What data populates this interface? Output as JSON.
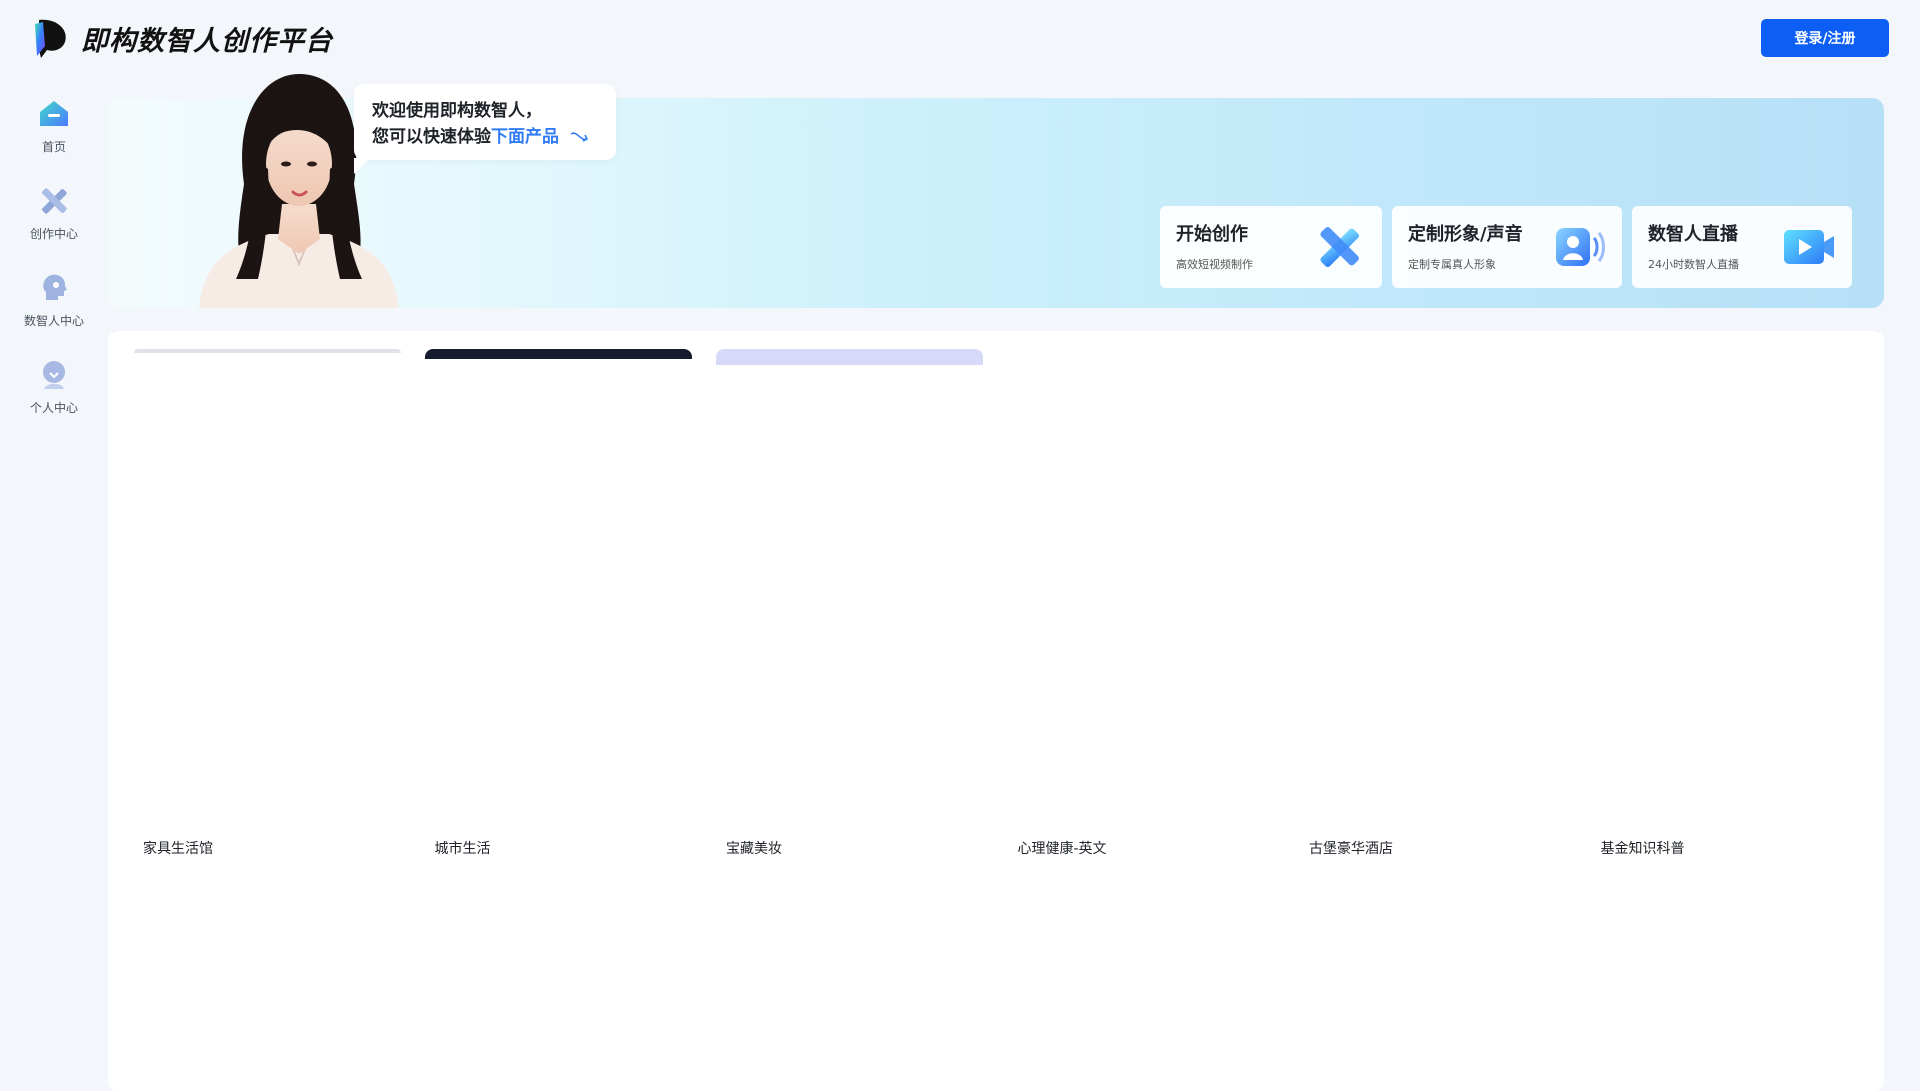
{
  "app": {
    "brand_name": "即构数智人创作平台",
    "login_label": "登录/注册",
    "accent_color": "#0d5ef5"
  },
  "sidebar": {
    "items": [
      {
        "label": "首页",
        "icon": "home-icon"
      },
      {
        "label": "创作中心",
        "icon": "creation-icon"
      },
      {
        "label": "数智人中心",
        "icon": "digital-human-icon"
      },
      {
        "label": "个人中心",
        "icon": "profile-icon"
      }
    ]
  },
  "banner": {
    "greeting_line1": "欢迎使用即构数智人，",
    "greeting_line2_prefix": "您可以快速体验",
    "greeting_line2_highlight": "下面产品",
    "cards": [
      {
        "title": "开始创作",
        "subtitle": "高效短视频制作",
        "icon": "pen-tool-icon"
      },
      {
        "title": "定制形象/声音",
        "subtitle": "定制专属真人形象",
        "icon": "avatar-voice-icon"
      },
      {
        "title": "数智人直播",
        "subtitle": "24小时数智人直播",
        "icon": "live-video-icon"
      }
    ]
  },
  "templates": {
    "items": [
      "家具生活馆",
      "城市生活",
      "宝藏美妆",
      "心理健康-英文",
      "古堡豪华酒店",
      "基金知识科普"
    ]
  }
}
